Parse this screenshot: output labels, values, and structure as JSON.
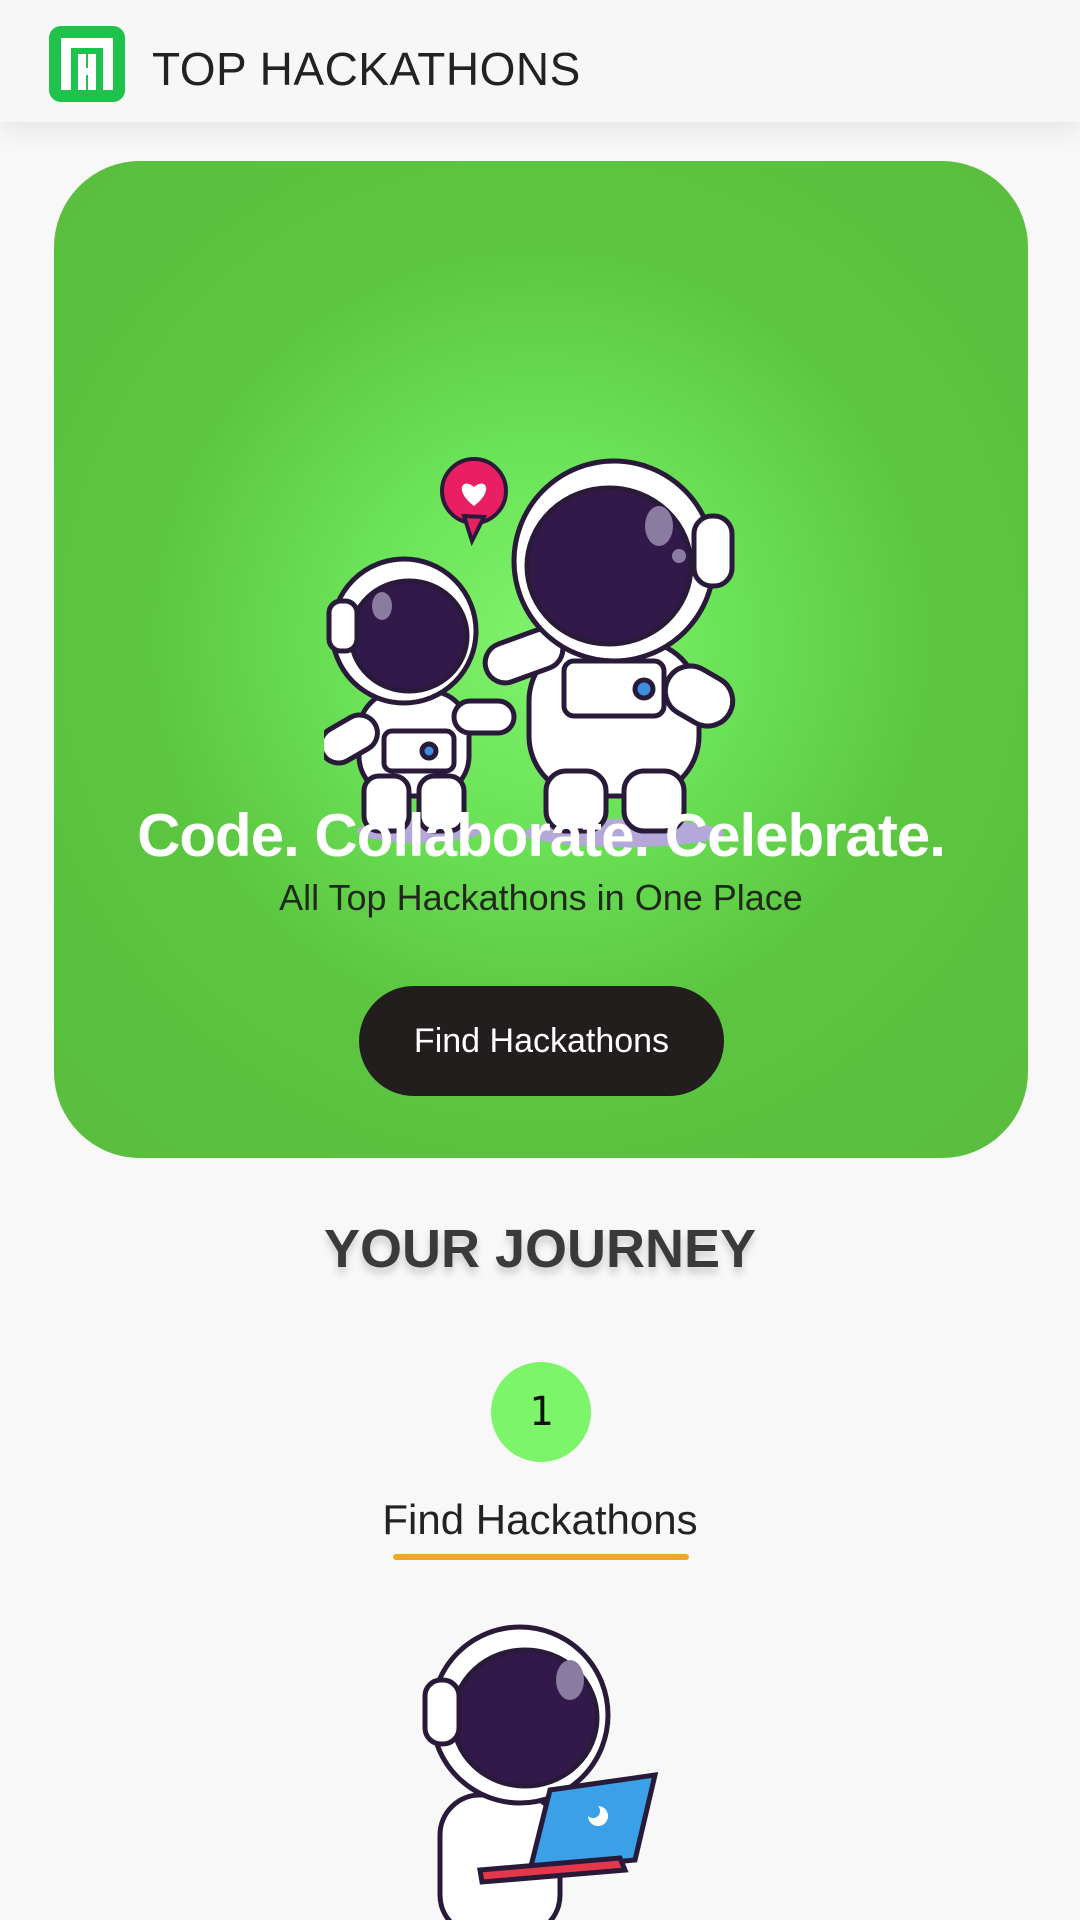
{
  "header": {
    "brand": "TOP HACKATHONS",
    "logo_icon": "th-logo-icon",
    "logo_color": "#1fc24a"
  },
  "hero": {
    "illustration": "astronauts-holding-hands-illustration",
    "tagline": "Code. Collaborate. Celebrate.",
    "subtitle": "All Top Hackathons in One Place",
    "cta_label": "Find Hackathons",
    "background_color": "#5cc640",
    "cta_color": "#221e1e"
  },
  "journey": {
    "title": "YOUR JOURNEY",
    "steps": [
      {
        "number": "1",
        "title": "Find Hackathons",
        "illustration": "astronaut-with-laptop-illustration",
        "badge_color": "#7df56a",
        "underline_color": "#f0a81e"
      }
    ]
  }
}
